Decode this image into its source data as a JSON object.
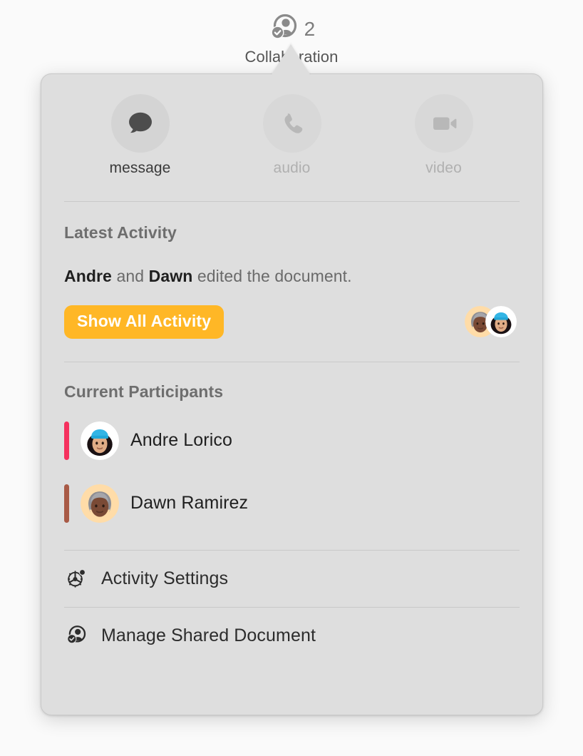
{
  "toolbar": {
    "icon": "person-checkmark-icon",
    "badge_count": "2",
    "label": "Collaboration"
  },
  "popover": {
    "background_color": "#dedede",
    "actions": [
      {
        "id": "message",
        "label": "message",
        "icon": "message-bubble-icon",
        "enabled": true
      },
      {
        "id": "audio",
        "label": "audio",
        "icon": "phone-icon",
        "enabled": false
      },
      {
        "id": "video",
        "label": "video",
        "icon": "video-camera-icon",
        "enabled": false
      }
    ],
    "latest_activity": {
      "title": "Latest Activity",
      "text_parts": [
        {
          "text": "Andre",
          "bold": true
        },
        {
          "text": " and ",
          "bold": false
        },
        {
          "text": "Dawn",
          "bold": true
        },
        {
          "text": " edited the document.",
          "bold": false
        }
      ],
      "summary_text": "Andre and Dawn edited the document.",
      "button_label": "Show All Activity",
      "button_color": "#ffb726",
      "avatars": [
        {
          "name": "Dawn Ramirez",
          "style": "older-gray-hair-memoji",
          "bg_color": "#ffdca8"
        },
        {
          "name": "Andre Lorico",
          "style": "blue-beanie-memoji",
          "bg_color": "#ffffff"
        }
      ]
    },
    "participants": {
      "title": "Current Participants",
      "list": [
        {
          "name": "Andre Lorico",
          "color": "#f5315e",
          "avatar_style": "blue-beanie-memoji",
          "avatar_bg": "#ffffff"
        },
        {
          "name": "Dawn Ramirez",
          "color": "#a85a46",
          "avatar_style": "older-gray-hair-memoji",
          "avatar_bg": "#ffdca8"
        }
      ]
    },
    "menu": [
      {
        "label": "Activity Settings",
        "icon": "gear-badge-icon"
      },
      {
        "label": "Manage Shared Document",
        "icon": "person-checkmark-icon"
      }
    ]
  }
}
